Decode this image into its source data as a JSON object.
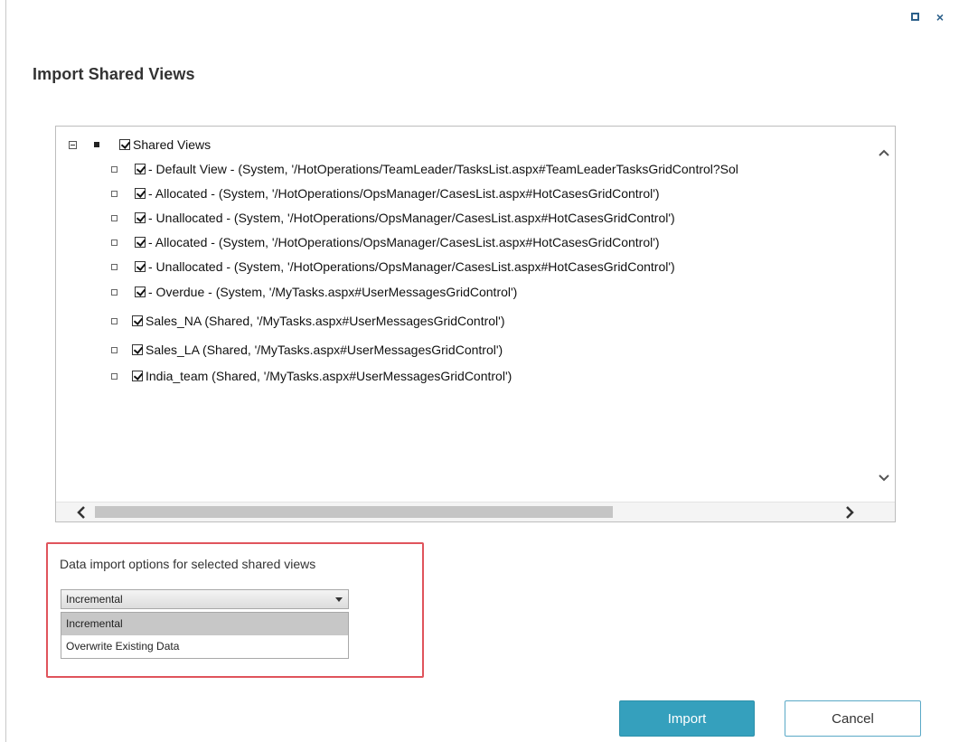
{
  "dialog": {
    "title": "Import Shared Views",
    "window_controls": {
      "maximize_icon": "maximize-icon",
      "close_icon": "close-icon",
      "close_glyph": "×"
    }
  },
  "tree": {
    "root": {
      "label": "Shared Views",
      "checked": true,
      "expanded": true
    },
    "items": [
      {
        "label": "- Default View - (System, '/HotOperations/TeamLeader/TasksList.aspx#TeamLeaderTasksGridControl?Sol",
        "checked": true
      },
      {
        "label": "- Allocated - (System, '/HotOperations/OpsManager/CasesList.aspx#HotCasesGridControl')",
        "checked": true
      },
      {
        "label": "- Unallocated - (System, '/HotOperations/OpsManager/CasesList.aspx#HotCasesGridControl')",
        "checked": true
      },
      {
        "label": "- Allocated - (System, '/HotOperations/OpsManager/CasesList.aspx#HotCasesGridControl')",
        "checked": true
      },
      {
        "label": "- Unallocated - (System, '/HotOperations/OpsManager/CasesList.aspx#HotCasesGridControl')",
        "checked": true
      },
      {
        "label": "- Overdue - (System, '/MyTasks.aspx#UserMessagesGridControl')",
        "checked": true
      },
      {
        "label": "Sales_NA (Shared, '/MyTasks.aspx#UserMessagesGridControl')",
        "checked": true
      },
      {
        "label": "Sales_LA (Shared, '/MyTasks.aspx#UserMessagesGridControl')",
        "checked": true
      },
      {
        "label": "India_team (Shared, '/MyTasks.aspx#UserMessagesGridControl')",
        "checked": true
      }
    ],
    "scroll": {
      "up": "^",
      "down": "v",
      "left": "<",
      "right": ">"
    }
  },
  "import_options": {
    "label": "Data import options for selected shared views",
    "selected": "Incremental",
    "options": [
      "Incremental",
      "Overwrite Existing Data"
    ]
  },
  "buttons": {
    "import": "Import",
    "cancel": "Cancel"
  },
  "colors": {
    "accent": "#35a0bd",
    "highlight_border": "#e0545c"
  }
}
